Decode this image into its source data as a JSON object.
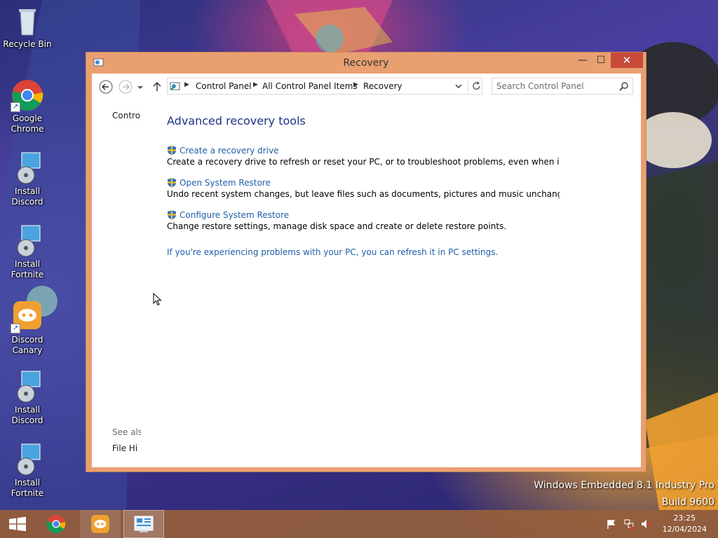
{
  "desktop": {
    "icons": [
      {
        "label": "Recycle Bin",
        "icon": "recycle-bin-icon"
      },
      {
        "label": "Google Chrome",
        "icon": "chrome-icon"
      },
      {
        "label": "Install Discord",
        "icon": "installer-icon"
      },
      {
        "label": "Install Fortnite",
        "icon": "installer-icon"
      },
      {
        "label": "Discord Canary",
        "icon": "discord-icon"
      },
      {
        "label": "Install Discord",
        "icon": "installer-icon"
      },
      {
        "label": "Install Fortnite",
        "icon": "installer-icon"
      }
    ],
    "watermark": {
      "line1": "Windows Embedded 8.1 Industry Pro",
      "line2": "Build 9600"
    }
  },
  "window": {
    "title": "Recovery",
    "controls": {
      "minimize": "—",
      "maximize": "☐",
      "close": "✕"
    },
    "breadcrumb": [
      "Control Panel",
      "All Control Panel Items",
      "Recovery"
    ],
    "search": {
      "placeholder": "Search Control Panel"
    },
    "left_pane": {
      "top_link": "Contro",
      "see_also": "See als",
      "file_history": "File Hi"
    },
    "main": {
      "heading": "Advanced recovery tools",
      "items": [
        {
          "link": "Create a recovery drive",
          "desc": "Create a recovery drive to refresh or reset your PC, or to troubleshoot problems, even when it can't star"
        },
        {
          "link": "Open System Restore",
          "desc": "Undo recent system changes, but leave files such as documents, pictures and music unchanged."
        },
        {
          "link": "Configure System Restore",
          "desc": "Change restore settings, manage disk space and create or delete restore points."
        }
      ],
      "refresh_link": "If you're experiencing problems with your PC, you can refresh it in PC settings."
    },
    "colors": {
      "frame": "#e9a071",
      "link": "#1e5ea8",
      "heading": "#1e3287"
    }
  },
  "taskbar": {
    "buttons": [
      {
        "name": "start-button",
        "icon": "windows-logo-icon"
      },
      {
        "name": "chrome-taskbar-button",
        "icon": "chrome-icon"
      },
      {
        "name": "discord-taskbar-button",
        "icon": "discord-icon"
      },
      {
        "name": "control-panel-taskbar-button",
        "icon": "control-panel-icon"
      }
    ],
    "clock": {
      "time": "23:25",
      "date": "12/04/2024"
    }
  }
}
